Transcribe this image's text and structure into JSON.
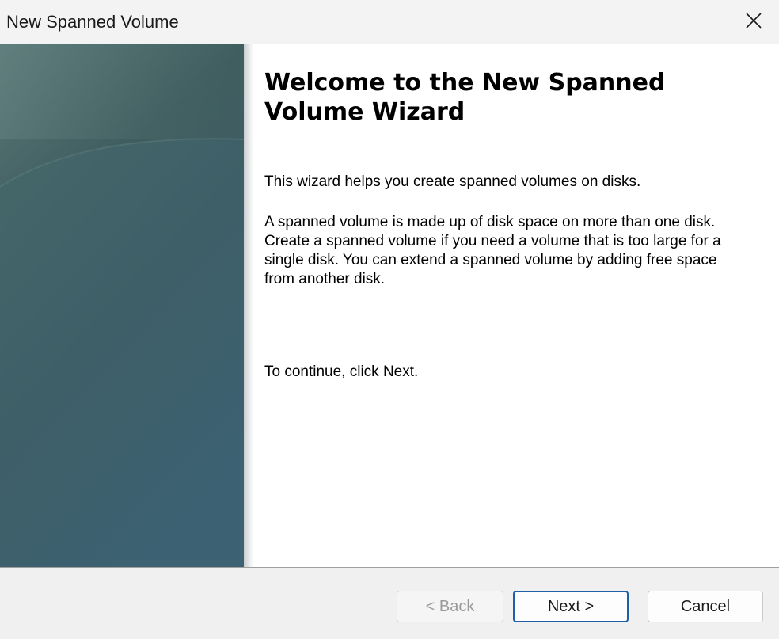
{
  "window": {
    "title": "New Spanned Volume",
    "close_icon": "close-icon"
  },
  "wizard": {
    "heading": "Welcome to the New Spanned Volume Wizard",
    "intro": "This wizard helps you create spanned volumes on disks.",
    "description": "A spanned volume is made up of disk space on more than one disk. Create a spanned volume if you need a volume that is too large for a single disk. You can extend a spanned volume by adding free space from another disk.",
    "instruction": "To continue, click Next."
  },
  "buttons": {
    "back_label": "< Back",
    "back_enabled": false,
    "next_label": "Next >",
    "cancel_label": "Cancel"
  },
  "colors": {
    "accent": "#1f5fa8",
    "side_panel_top": "#577675",
    "side_panel_bottom": "#3d5e66"
  }
}
